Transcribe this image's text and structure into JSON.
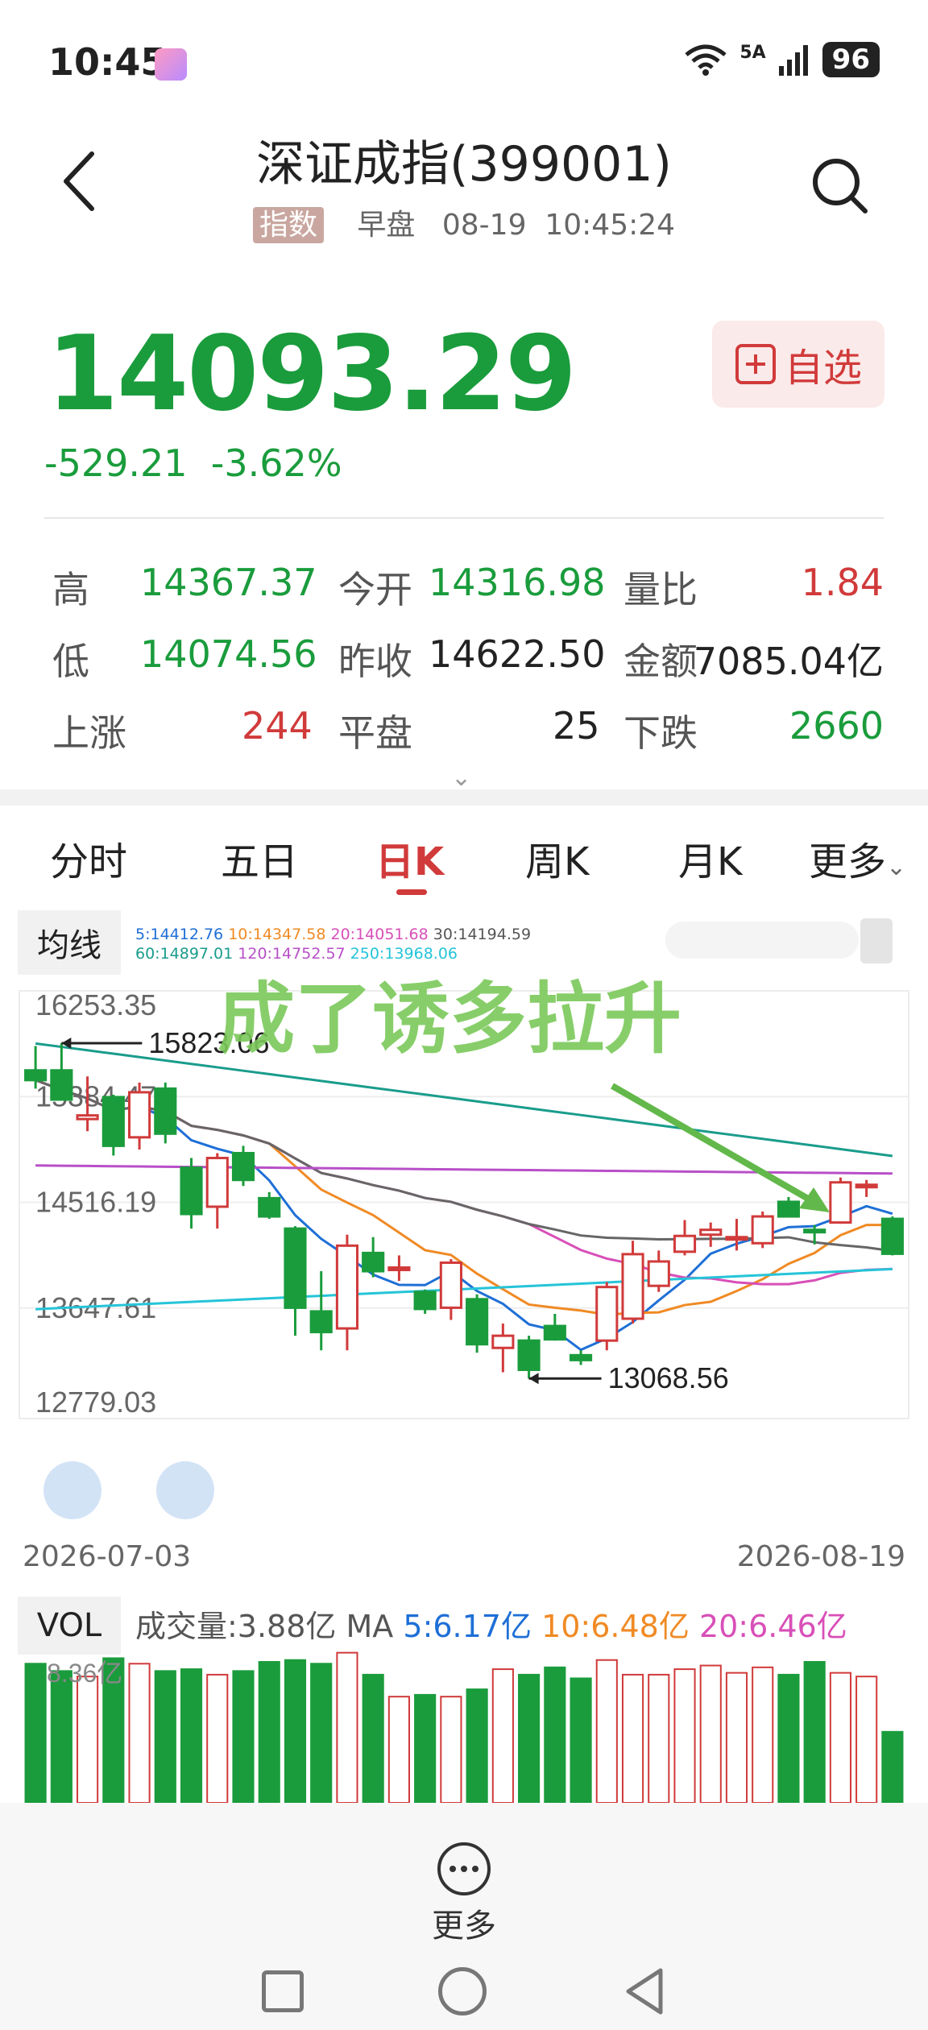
{
  "status_bar": {
    "time": "10:45",
    "network": "5A",
    "battery": "96"
  },
  "header": {
    "title": "深证成指(399001)",
    "tag": "指数",
    "session": "早盘",
    "datetime": "08-19  10:45:24"
  },
  "quote": {
    "price": "14093.29",
    "change": "-529.21  -3.62%",
    "watch_label": "自选"
  },
  "stats": {
    "high_label": "高",
    "high": "14367.37",
    "open_label": "今开",
    "open": "14316.98",
    "ratio_label": "量比",
    "ratio": "1.84",
    "low_label": "低",
    "low": "14074.56",
    "prev_label": "昨收",
    "prev": "14622.50",
    "amount_label": "金额",
    "amount": "7085.04亿",
    "up_label": "上涨",
    "up": "244",
    "flat_label": "平盘",
    "flat": "25",
    "down_label": "下跌",
    "down": "2660"
  },
  "tabs": [
    "分时",
    "五日",
    "日K",
    "周K",
    "月K",
    "更多"
  ],
  "active_tab": "日K",
  "ma_panel": {
    "tag": "均线",
    "ma5": "5:14412.76",
    "ma10": "10:14347.58",
    "ma20": "20:14051.68",
    "ma30": "30:14194.59",
    "ma60": "60:14897.01",
    "ma120": "120:14752.57",
    "ma250": "250:13968.06"
  },
  "colors": {
    "up": "#d13a3a",
    "down": "#1a9c3c",
    "ma5": "#1e6fd6",
    "ma10": "#f08a24",
    "ma20": "#d84fb8",
    "ma30": "#666666",
    "ma60": "#1a9c8c",
    "ma120": "#b84fc8",
    "ma250": "#25c4d8"
  },
  "chart_data": {
    "type": "candlestick",
    "y_labels": [
      "16253.35",
      "15384.47",
      "14516.19",
      "13647.61",
      "12779.03"
    ],
    "ylim": [
      12779.03,
      16253.35
    ],
    "date_start": "2026-07-03",
    "date_end": "2026-08-19",
    "high_marker": "15823.06",
    "low_marker": "13068.56",
    "annotation": "成了诱多拉升",
    "candles": [
      {
        "o": 15600,
        "h": 15800,
        "l": 15450,
        "c": 15520
      },
      {
        "o": 15600,
        "h": 15823,
        "l": 15350,
        "c": 15360
      },
      {
        "o": 15200,
        "h": 15550,
        "l": 15100,
        "c": 15230
      },
      {
        "o": 15380,
        "h": 15400,
        "l": 14900,
        "c": 14980
      },
      {
        "o": 15050,
        "h": 15500,
        "l": 14950,
        "c": 15420
      },
      {
        "o": 15450,
        "h": 15500,
        "l": 15000,
        "c": 15080
      },
      {
        "o": 14800,
        "h": 14880,
        "l": 14300,
        "c": 14420
      },
      {
        "o": 14480,
        "h": 14920,
        "l": 14300,
        "c": 14880
      },
      {
        "o": 14920,
        "h": 14980,
        "l": 14650,
        "c": 14700
      },
      {
        "o": 14550,
        "h": 14600,
        "l": 14380,
        "c": 14400
      },
      {
        "o": 14300,
        "h": 14320,
        "l": 13420,
        "c": 13650
      },
      {
        "o": 13620,
        "h": 13950,
        "l": 13300,
        "c": 13450
      },
      {
        "o": 13480,
        "h": 14250,
        "l": 13300,
        "c": 14160
      },
      {
        "o": 14100,
        "h": 14230,
        "l": 13900,
        "c": 13950
      },
      {
        "o": 13980,
        "h": 14080,
        "l": 13870,
        "c": 13980
      },
      {
        "o": 13780,
        "h": 13800,
        "l": 13600,
        "c": 13640
      },
      {
        "o": 13650,
        "h": 14050,
        "l": 13550,
        "c": 14020
      },
      {
        "o": 13720,
        "h": 13760,
        "l": 13280,
        "c": 13350
      },
      {
        "o": 13320,
        "h": 13520,
        "l": 13120,
        "c": 13420
      },
      {
        "o": 13380,
        "h": 13420,
        "l": 13068.56,
        "c": 13140
      },
      {
        "o": 13500,
        "h": 13600,
        "l": 13380,
        "c": 13390
      },
      {
        "o": 13260,
        "h": 13300,
        "l": 13180,
        "c": 13220
      },
      {
        "o": 13380,
        "h": 13860,
        "l": 13300,
        "c": 13820
      },
      {
        "o": 13560,
        "h": 14200,
        "l": 13520,
        "c": 14090
      },
      {
        "o": 13830,
        "h": 14120,
        "l": 13780,
        "c": 14030
      },
      {
        "o": 14110,
        "h": 14370,
        "l": 14080,
        "c": 14240
      },
      {
        "o": 14250,
        "h": 14350,
        "l": 14150,
        "c": 14290
      },
      {
        "o": 14220,
        "h": 14380,
        "l": 14120,
        "c": 14230
      },
      {
        "o": 14180,
        "h": 14440,
        "l": 14140,
        "c": 14400
      },
      {
        "o": 14520,
        "h": 14560,
        "l": 14400,
        "c": 14400
      },
      {
        "o": 14290,
        "h": 14330,
        "l": 14170,
        "c": 14280
      },
      {
        "o": 14350,
        "h": 14720,
        "l": 14340,
        "c": 14680
      },
      {
        "o": 14650,
        "h": 14700,
        "l": 14560,
        "c": 14660
      },
      {
        "o": 14380,
        "h": 14400,
        "l": 14080,
        "c": 14093.29
      }
    ],
    "volume": {
      "label": "成交量:3.88亿",
      "ma_label": "MA",
      "ma5": "5:6.17亿",
      "ma10": "10:6.48亿",
      "ma20": "20:6.46亿",
      "max_label": "8.36亿"
    }
  },
  "bottom": {
    "more_label": "更多"
  }
}
